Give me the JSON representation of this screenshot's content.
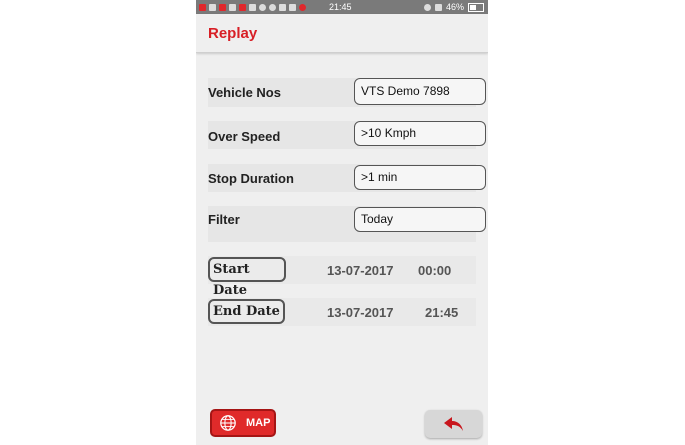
{
  "status_bar": {
    "time": "21:45",
    "battery": "46%"
  },
  "app_bar": {
    "title": "Replay"
  },
  "form": {
    "vehicle": {
      "label": "Vehicle Nos",
      "value": "VTS Demo 7898"
    },
    "over_speed": {
      "label": "Over Speed",
      "value": ">10 Kmph"
    },
    "stop_duration": {
      "label": "Stop Duration",
      "value": ">1 min"
    },
    "filter": {
      "label": "Filter",
      "value": "Today"
    }
  },
  "start": {
    "label": "Start Date",
    "date": "13-07-2017",
    "time": "00:00"
  },
  "end": {
    "label": "End Date",
    "date": "13-07-2017",
    "time": "21:45"
  },
  "buttons": {
    "map_label": "MAP"
  },
  "colors": {
    "accent": "#d81f26",
    "background": "#efefef"
  },
  "icons": {
    "map": "globe-icon",
    "back": "back-arrow-icon"
  }
}
